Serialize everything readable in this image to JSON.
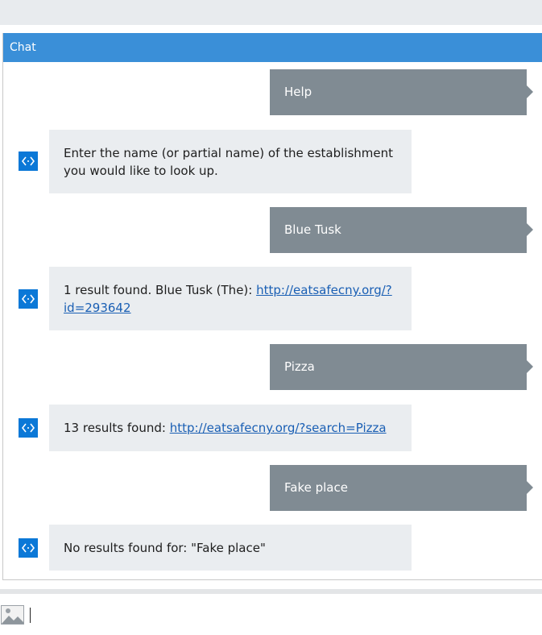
{
  "chat": {
    "title": "Chat",
    "messages": [
      {
        "from": "user",
        "text": "Help"
      },
      {
        "from": "bot",
        "text": "Enter the name (or partial name) of the establishment you would like to look up."
      },
      {
        "from": "user",
        "text": "Blue Tusk"
      },
      {
        "from": "bot",
        "text": "1 result found. Blue Tusk (The): ",
        "link": "http://eatsafecny.org/?id=293642"
      },
      {
        "from": "user",
        "text": "Pizza"
      },
      {
        "from": "bot",
        "text": "13 results found: ",
        "link": "http://eatsafecny.org/?search=Pizza"
      },
      {
        "from": "user",
        "text": "Fake place"
      },
      {
        "from": "bot",
        "text": "No results found for: \"Fake place\""
      }
    ]
  },
  "composer": {
    "attachment_icon": "image-icon",
    "input_value": ""
  },
  "colors": {
    "header": "#3a8fd8",
    "user_bubble": "#808b93",
    "bot_bubble": "#eaedf0",
    "bot_avatar": "#0b78d7",
    "link": "#1a5fb4"
  }
}
